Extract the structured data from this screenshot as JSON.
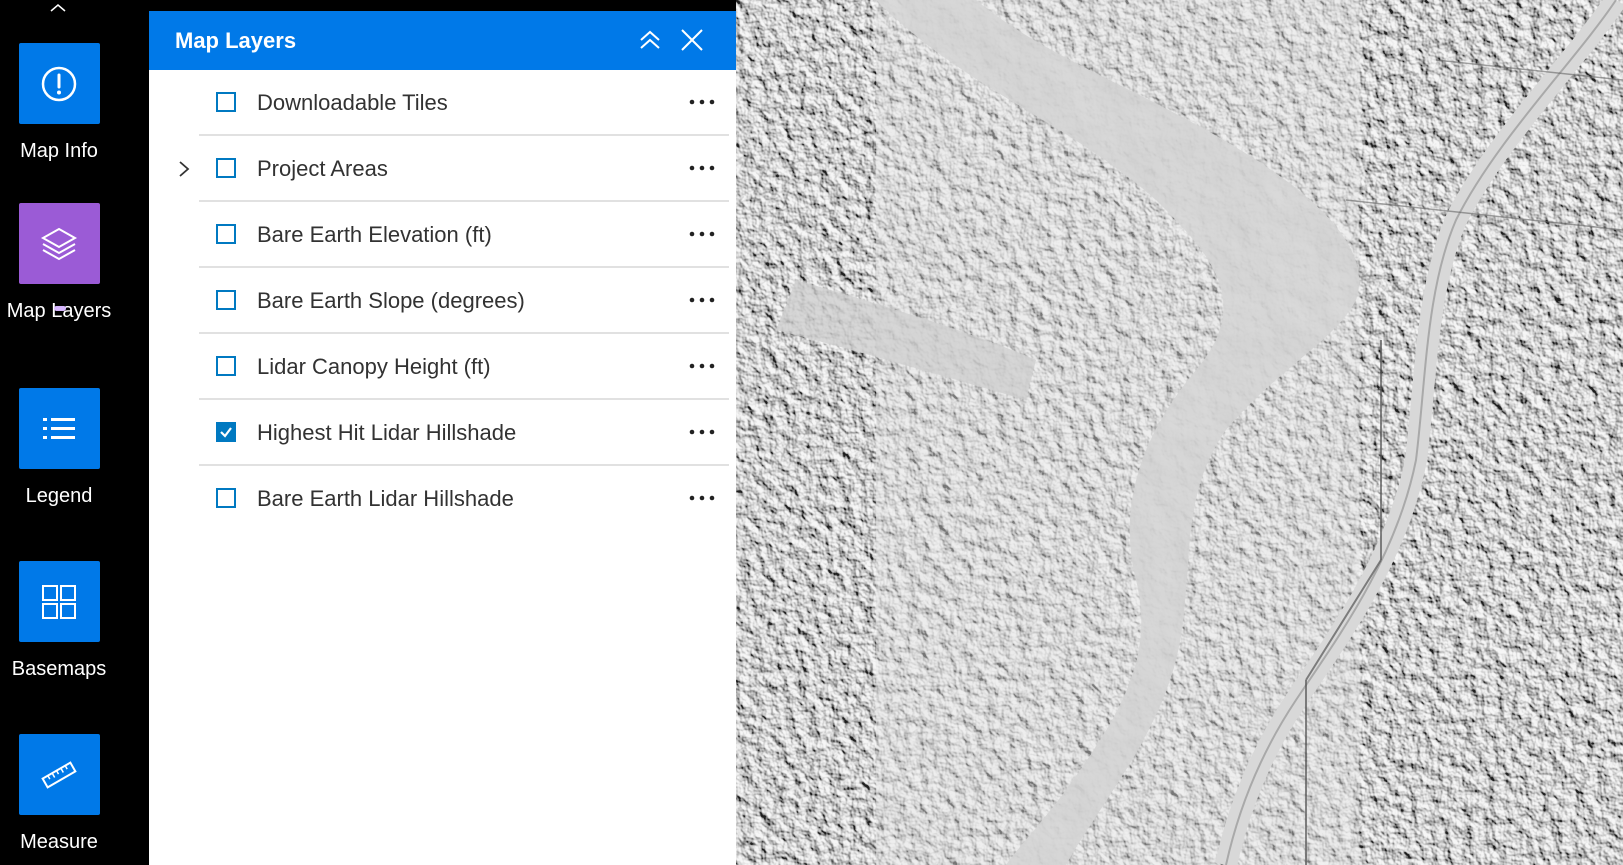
{
  "colors": {
    "accent": "#0079c1",
    "header_bg": "#0079e8",
    "active_tool": "#9b5bd6",
    "toolbar_bg": "#000000"
  },
  "toolbar": {
    "items": [
      {
        "label": "Map Info",
        "icon": "info-icon",
        "active": false
      },
      {
        "label": "Map Layers",
        "icon": "layers-icon",
        "active": true
      },
      {
        "label": "Legend",
        "icon": "list-icon",
        "active": false
      },
      {
        "label": "Basemaps",
        "icon": "grid-icon",
        "active": false
      },
      {
        "label": "Measure",
        "icon": "ruler-icon",
        "active": false
      }
    ]
  },
  "panel": {
    "title": "Map Layers",
    "layers": [
      {
        "title": "Downloadable Tiles",
        "checked": false,
        "expandable": false
      },
      {
        "title": "Project Areas",
        "checked": false,
        "expandable": true
      },
      {
        "title": "Bare Earth Elevation (ft)",
        "checked": false,
        "expandable": false
      },
      {
        "title": "Bare Earth Slope (degrees)",
        "checked": false,
        "expandable": false
      },
      {
        "title": "Lidar Canopy Height (ft)",
        "checked": false,
        "expandable": false
      },
      {
        "title": "Highest Hit Lidar Hillshade",
        "checked": true,
        "expandable": false
      },
      {
        "title": "Bare Earth Lidar Hillshade",
        "checked": false,
        "expandable": false
      }
    ]
  }
}
